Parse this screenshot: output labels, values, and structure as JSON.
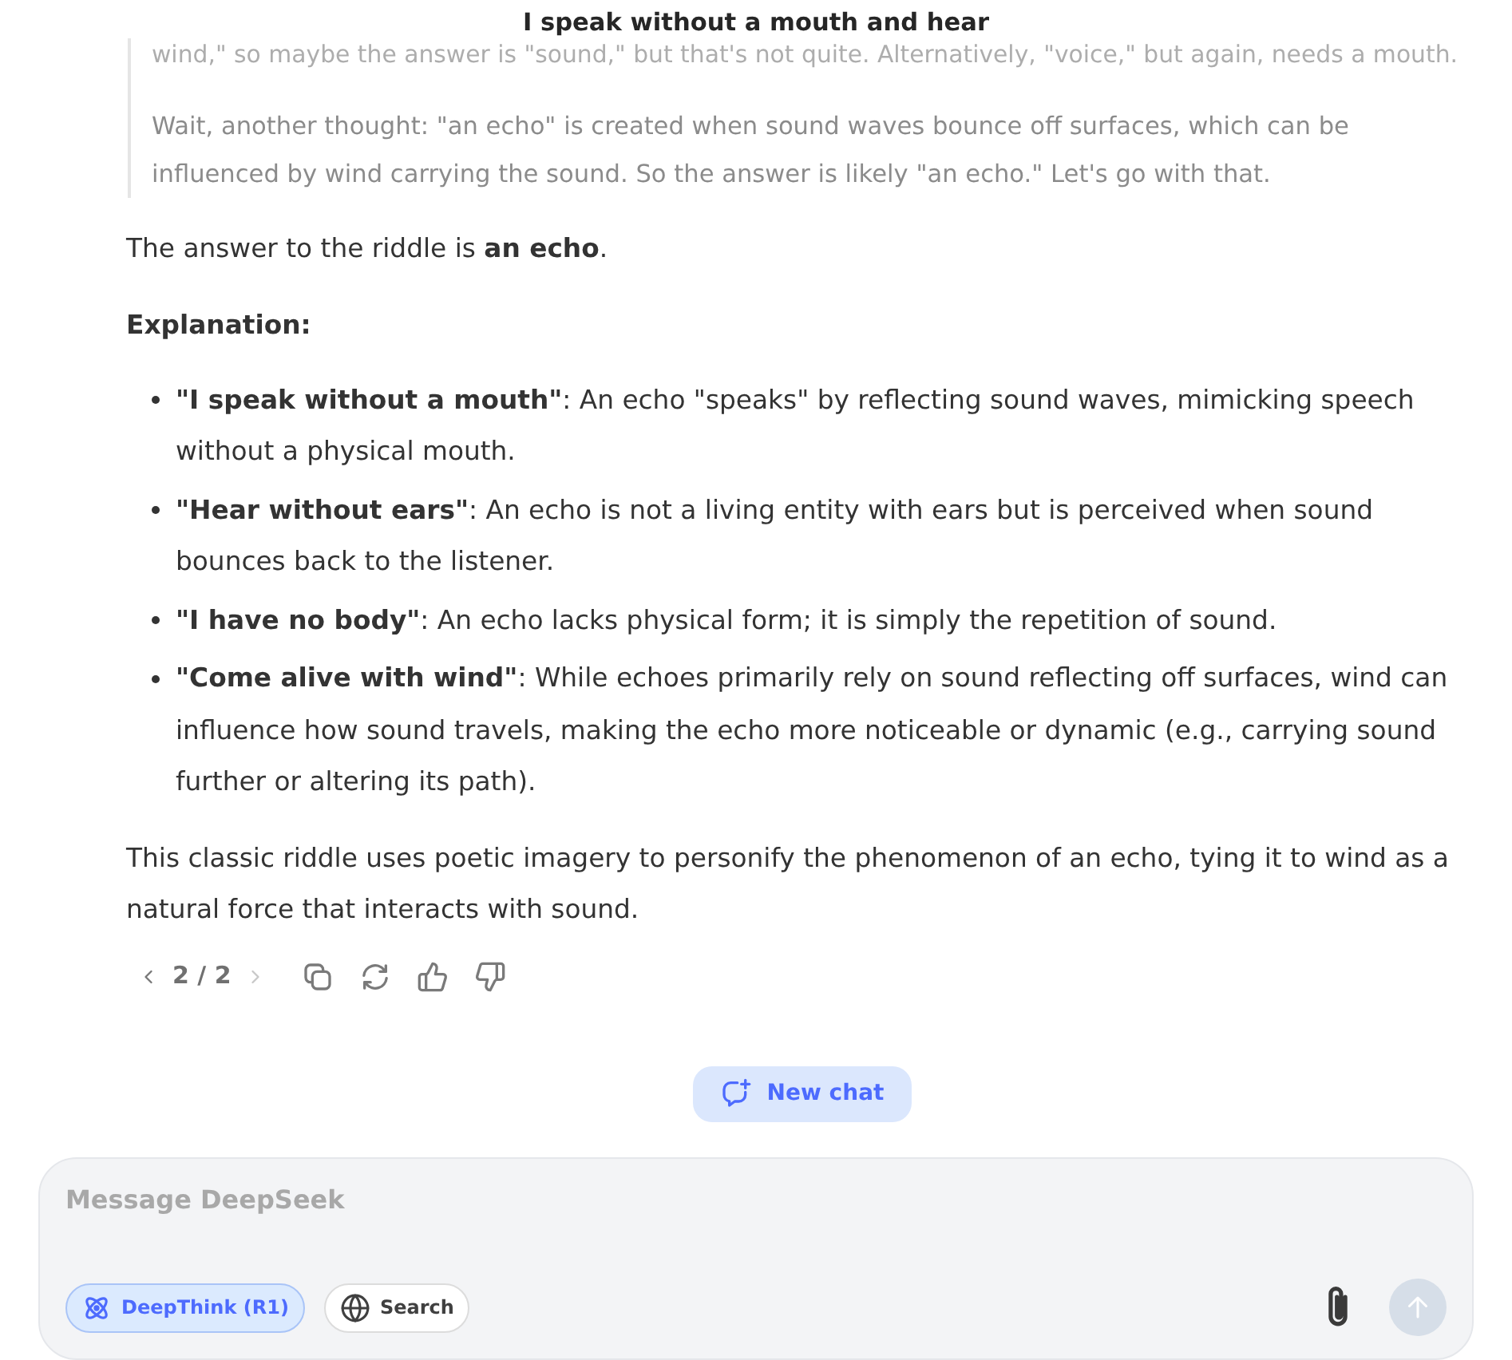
{
  "header": {
    "title": "I speak without a mouth and hear"
  },
  "thinking": {
    "paragraphs": [
      "wind,\" so maybe the answer is \"sound,\" but that's not quite. Alternatively, \"voice,\" but again, needs a mouth.",
      "Wait, another thought: \"an echo\" is created when sound waves bounce off surfaces, which can be influenced by wind carrying the sound. So the answer is likely \"an echo.\" Let's go with that."
    ]
  },
  "answer": {
    "blocks": [
      {
        "kind": "paragraph",
        "text": "The answer to the riddle is **an echo**."
      },
      {
        "kind": "heading",
        "text": "Explanation:"
      },
      {
        "kind": "list",
        "items": [
          "**\"I speak without a mouth\"**: An echo \"speaks\" by reflecting sound waves, mimicking speech without a physical mouth.",
          "**\"Hear without ears\"**: An echo is not a living entity with ears but is perceived when sound bounces back to the listener.",
          "**\"I have no body\"**: An echo lacks physical form; it is simply the repetition of sound.",
          "**\"Come alive with wind\"**: While echoes primarily rely on sound reflecting off surfaces, wind can influence how sound travels, making the echo more noticeable or dynamic (e.g., carrying sound further or altering its path)."
        ]
      },
      {
        "kind": "paragraph",
        "text": "This classic riddle uses poetic imagery to personify the phenomenon of an echo, tying it to wind as a natural force that interacts with sound."
      }
    ]
  },
  "actions": {
    "pager": "2 / 2",
    "previous": {
      "disabled": false
    },
    "next": {
      "disabled": true
    }
  },
  "new_chat": {
    "label": "New chat"
  },
  "composer": {
    "placeholder": "Message DeepSeek",
    "toggles": [
      {
        "label": "DeepThink (R1)",
        "selected": true
      },
      {
        "label": "Search",
        "selected": false
      }
    ],
    "send": {
      "disabled": true
    }
  }
}
